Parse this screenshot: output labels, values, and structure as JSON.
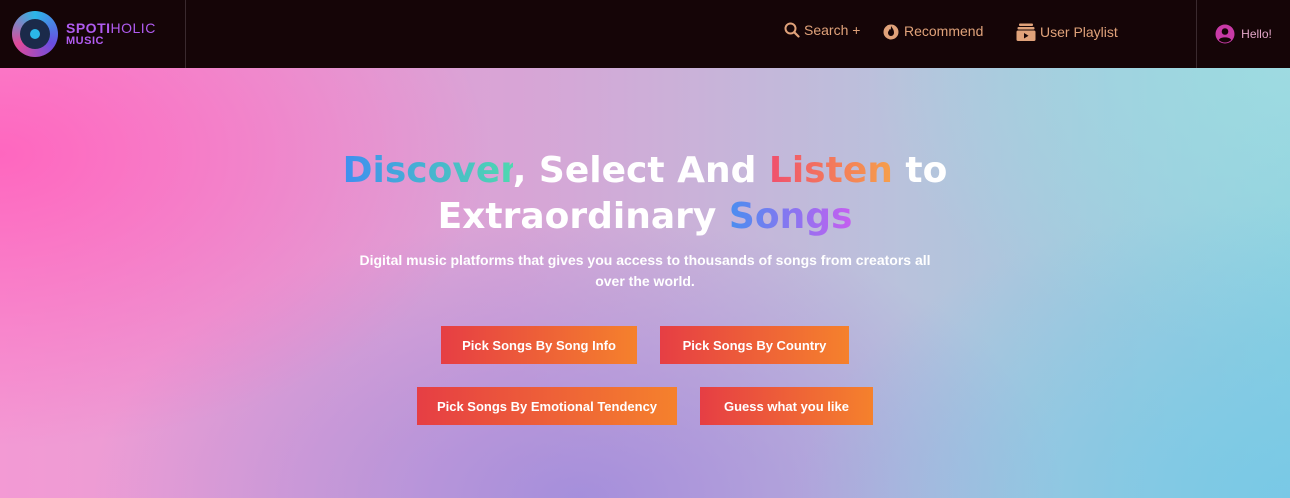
{
  "brand": {
    "name_part1": "SPOTI",
    "name_part2": "HOLIC",
    "name_line2": "MUSIC"
  },
  "nav": {
    "search_label": "Search +",
    "recommend_label": "Recommend",
    "playlist_label": "User Playlist",
    "user_greeting": "Hello!"
  },
  "hero": {
    "title_discover": "Discover",
    "title_mid": ", Select And ",
    "title_listen": "Listen",
    "title_to": " to",
    "title_line2_a": "Extraordinary ",
    "title_songs": "Songs",
    "subtitle": "Digital music platforms that gives you access to thousands of songs from creators all over the world."
  },
  "buttons": {
    "song_info": "Pick Songs By Song Info",
    "country": "Pick Songs By Country",
    "emotional": "Pick Songs By Emotional Tendency",
    "guess": "Guess what you like"
  },
  "colors": {
    "nav_bg": "#150507",
    "nav_link": "#e0a27a",
    "brand": "#b05cf0",
    "button_start": "#e63e44",
    "button_end": "#f5812c"
  },
  "icons": {
    "search": "search-icon",
    "recommend": "fire-icon",
    "playlist": "playlist-icon",
    "user": "user-circle-icon",
    "logo": "vinyl-headphones-logo"
  }
}
